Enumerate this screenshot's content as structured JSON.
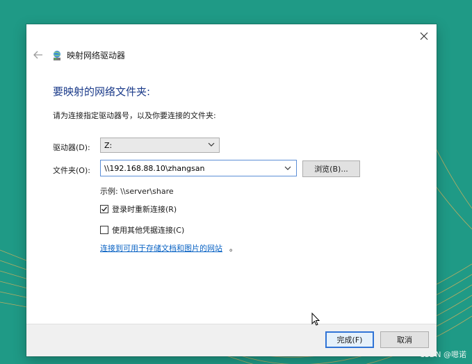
{
  "dialog": {
    "title": "映射网络驱动器",
    "heading": "要映射的网络文件夹:",
    "instruction": "请为连接指定驱动器号，以及你要连接的文件夹:",
    "drive_label": "驱动器(D):",
    "drive_value": "Z:",
    "folder_label": "文件夹(O):",
    "folder_value": "\\\\192.168.88.10\\zhangsan",
    "browse_label": "浏览(B)...",
    "example_text": "示例: \\\\server\\share",
    "reconnect_label": "登录时重新连接(R)",
    "reconnect_checked": true,
    "other_creds_label": "使用其他凭据连接(C)",
    "other_creds_checked": false,
    "link_text": "连接到可用于存储文档和图片的网站",
    "link_suffix": "。",
    "finish_label": "完成(F)",
    "cancel_label": "取消"
  },
  "watermark": "CSDN @嗯诺",
  "colors": {
    "heading": "#1b3b8a",
    "link": "#0a63c4",
    "default_button_border": "#2f73d6",
    "desktop": "#1f9a86"
  }
}
